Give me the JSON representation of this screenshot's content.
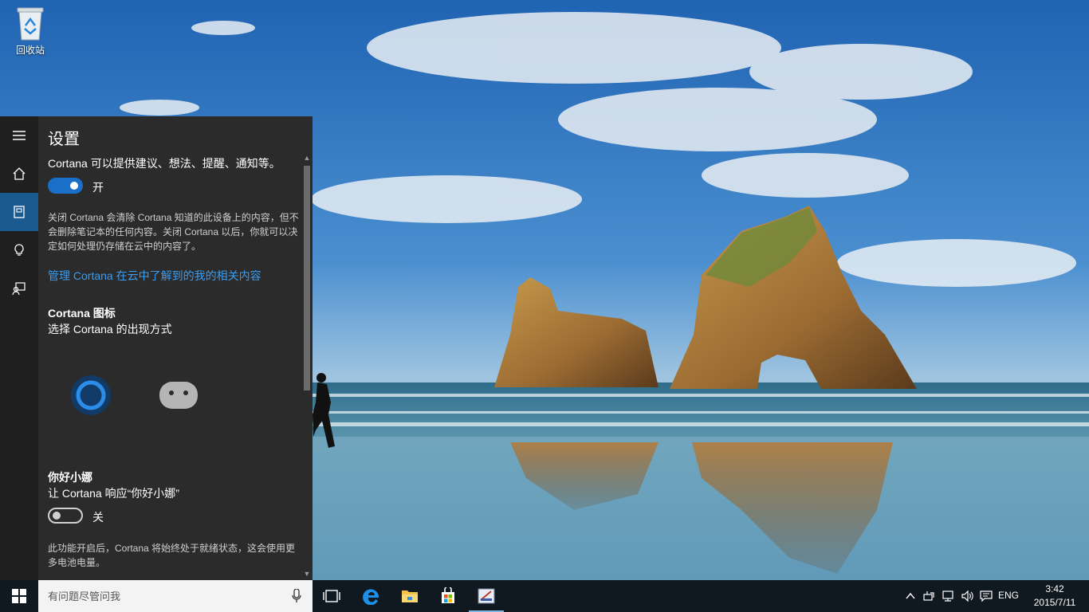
{
  "desktop": {
    "recycle_bin_label": "回收站"
  },
  "cortana_panel": {
    "title": "设置",
    "rail": [
      "hamburger-icon",
      "home-icon",
      "notebook-icon",
      "lightbulb-icon",
      "feedback-icon"
    ],
    "suggestions": {
      "description": "Cortana 可以提供建议、想法、提醒、通知等。",
      "toggle_state": "开",
      "toggle_on": true,
      "note": "关闭 Cortana 会清除 Cortana 知道的此设备上的内容，但不会删除笔记本的任何内容。关闭 Cortana 以后，你就可以决定如何处理仍存储在云中的内容了。"
    },
    "manage_link": "管理 Cortana 在云中了解到的我的相关内容",
    "icon_section": {
      "title": "Cortana 图标",
      "subtitle": "选择 Cortana 的出现方式",
      "options": [
        "cortana-circle-icon",
        "cortana-face-icon"
      ]
    },
    "hey_section": {
      "title": "你好小娜",
      "subtitle": "让 Cortana 响应“你好小娜”",
      "toggle_state": "关",
      "toggle_on": false,
      "note": "此功能开启后，Cortana 将始终处于就绪状态，这会使用更多电池电量。"
    }
  },
  "taskbar": {
    "search_placeholder": "有问题尽管问我",
    "apps": [
      "task-view-icon",
      "edge-icon",
      "file-explorer-icon",
      "store-icon",
      "running-app-icon"
    ],
    "tray": [
      "chevron-up-icon",
      "tray-device-icon",
      "network-icon",
      "volume-icon",
      "action-center-icon"
    ],
    "language": "ENG",
    "time": "3:42",
    "date": "2015/7/11"
  },
  "colors": {
    "accent": "#1a6fc8",
    "link": "#3b9cf0",
    "panel_bg": "#2b2b2b",
    "rail_bg": "#1f1f1f",
    "taskbar_bg": "#101820"
  }
}
